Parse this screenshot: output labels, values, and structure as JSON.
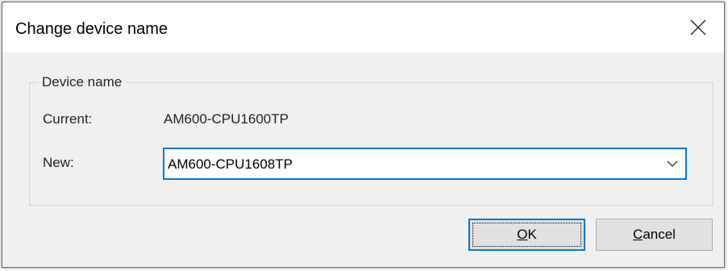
{
  "window": {
    "title": "Change device name"
  },
  "group": {
    "legend": "Device name",
    "current_label": "Current:",
    "current_value": "AM600-CPU1600TP",
    "new_label": "New:",
    "new_value": "AM600-CPU1608TP"
  },
  "buttons": {
    "ok_mnemonic": "O",
    "ok_rest": "K",
    "cancel_mnemonic": "C",
    "cancel_rest": "ancel"
  },
  "icons": {
    "close": "close-icon",
    "dropdown": "chevron-down-icon"
  },
  "colors": {
    "accent": "#0078d7",
    "dialog_bg": "#f0f0f0",
    "button_bg": "#e1e1e1"
  }
}
